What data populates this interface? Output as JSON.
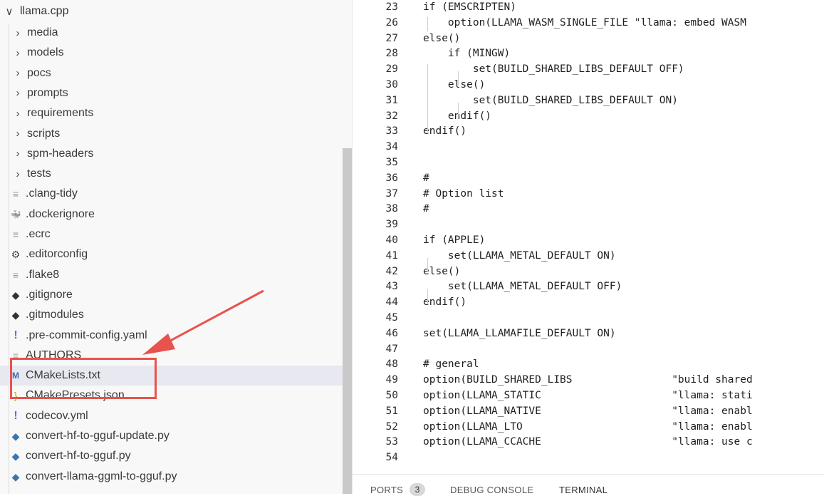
{
  "explorer": {
    "root_label": "llama.cpp",
    "items": [
      {
        "label": "media",
        "kind": "folder"
      },
      {
        "label": "models",
        "kind": "folder"
      },
      {
        "label": "pocs",
        "kind": "folder"
      },
      {
        "label": "prompts",
        "kind": "folder"
      },
      {
        "label": "requirements",
        "kind": "folder"
      },
      {
        "label": "scripts",
        "kind": "folder"
      },
      {
        "label": "spm-headers",
        "kind": "folder"
      },
      {
        "label": "tests",
        "kind": "folder"
      },
      {
        "label": ".clang-tidy",
        "kind": "file",
        "icon": "lines-icon",
        "icon_color": "#999999"
      },
      {
        "label": ".dockerignore",
        "kind": "file",
        "icon": "docker-icon",
        "icon_color": "#444444"
      },
      {
        "label": ".ecrc",
        "kind": "file",
        "icon": "lines-icon",
        "icon_color": "#999999"
      },
      {
        "label": ".editorconfig",
        "kind": "file",
        "icon": "gear-icon",
        "icon_color": "#444444"
      },
      {
        "label": ".flake8",
        "kind": "file",
        "icon": "lines-icon",
        "icon_color": "#999999"
      },
      {
        "label": ".gitignore",
        "kind": "file",
        "icon": "git-icon",
        "icon_color": "#333333"
      },
      {
        "label": ".gitmodules",
        "kind": "file",
        "icon": "git-icon",
        "icon_color": "#333333"
      },
      {
        "label": ".pre-commit-config.yaml",
        "kind": "file",
        "icon": "exclamation-icon",
        "icon_color": "#8a5cc7"
      },
      {
        "label": "AUTHORS",
        "kind": "file",
        "icon": "lines-icon",
        "icon_color": "#999999"
      },
      {
        "label": "CMakeLists.txt",
        "kind": "file",
        "icon": "cmake-icon",
        "icon_color": "#3b6ea8",
        "selected": true
      },
      {
        "label": "CMakePresets.json",
        "kind": "file",
        "icon": "braces-icon",
        "icon_color": "#c9a227"
      },
      {
        "label": "codecov.yml",
        "kind": "file",
        "icon": "exclamation-icon",
        "icon_color": "#8a5cc7"
      },
      {
        "label": "convert-hf-to-gguf-update.py",
        "kind": "file",
        "icon": "python-icon",
        "icon_color": "#3a75b0"
      },
      {
        "label": "convert-hf-to-gguf.py",
        "kind": "file",
        "icon": "python-icon",
        "icon_color": "#3a75b0"
      },
      {
        "label": "convert-llama-ggml-to-gguf.py",
        "kind": "file",
        "icon": "python-icon",
        "icon_color": "#3a75b0"
      }
    ]
  },
  "editor": {
    "lines": [
      {
        "n": "23",
        "text": "if (EMSCRIPTEN)"
      },
      {
        "n": "26",
        "text": "    option(LLAMA_WASM_SINGLE_FILE \"llama: embed WASM"
      },
      {
        "n": "27",
        "text": "else()"
      },
      {
        "n": "28",
        "text": "    if (MINGW)"
      },
      {
        "n": "29",
        "text": "        set(BUILD_SHARED_LIBS_DEFAULT OFF)"
      },
      {
        "n": "30",
        "text": "    else()"
      },
      {
        "n": "31",
        "text": "        set(BUILD_SHARED_LIBS_DEFAULT ON)"
      },
      {
        "n": "32",
        "text": "    endif()"
      },
      {
        "n": "33",
        "text": "endif()"
      },
      {
        "n": "34",
        "text": ""
      },
      {
        "n": "35",
        "text": ""
      },
      {
        "n": "36",
        "text": "#"
      },
      {
        "n": "37",
        "text": "# Option list"
      },
      {
        "n": "38",
        "text": "#"
      },
      {
        "n": "39",
        "text": ""
      },
      {
        "n": "40",
        "text": "if (APPLE)"
      },
      {
        "n": "41",
        "text": "    set(LLAMA_METAL_DEFAULT ON)"
      },
      {
        "n": "42",
        "text": "else()"
      },
      {
        "n": "43",
        "text": "    set(LLAMA_METAL_DEFAULT OFF)"
      },
      {
        "n": "44",
        "text": "endif()"
      },
      {
        "n": "45",
        "text": ""
      },
      {
        "n": "46",
        "text": "set(LLAMA_LLAMAFILE_DEFAULT ON)"
      },
      {
        "n": "47",
        "text": ""
      },
      {
        "n": "48",
        "text": "# general"
      },
      {
        "n": "49",
        "text": "option(BUILD_SHARED_LIBS                \"build shared"
      },
      {
        "n": "50",
        "text": "option(LLAMA_STATIC                     \"llama: stati"
      },
      {
        "n": "51",
        "text": "option(LLAMA_NATIVE                     \"llama: enabl"
      },
      {
        "n": "52",
        "text": "option(LLAMA_LTO                        \"llama: enabl"
      },
      {
        "n": "53",
        "text": "option(LLAMA_CCACHE                     \"llama: use c"
      },
      {
        "n": "54",
        "text": ""
      }
    ]
  },
  "panel": {
    "ports_label": "PORTS",
    "ports_count": "3",
    "debug_label": "DEBUG CONSOLE",
    "terminal_label": "TERMINAL"
  },
  "colors": {
    "callout": "#e8534e",
    "selected_row": "#e8e8f0"
  }
}
